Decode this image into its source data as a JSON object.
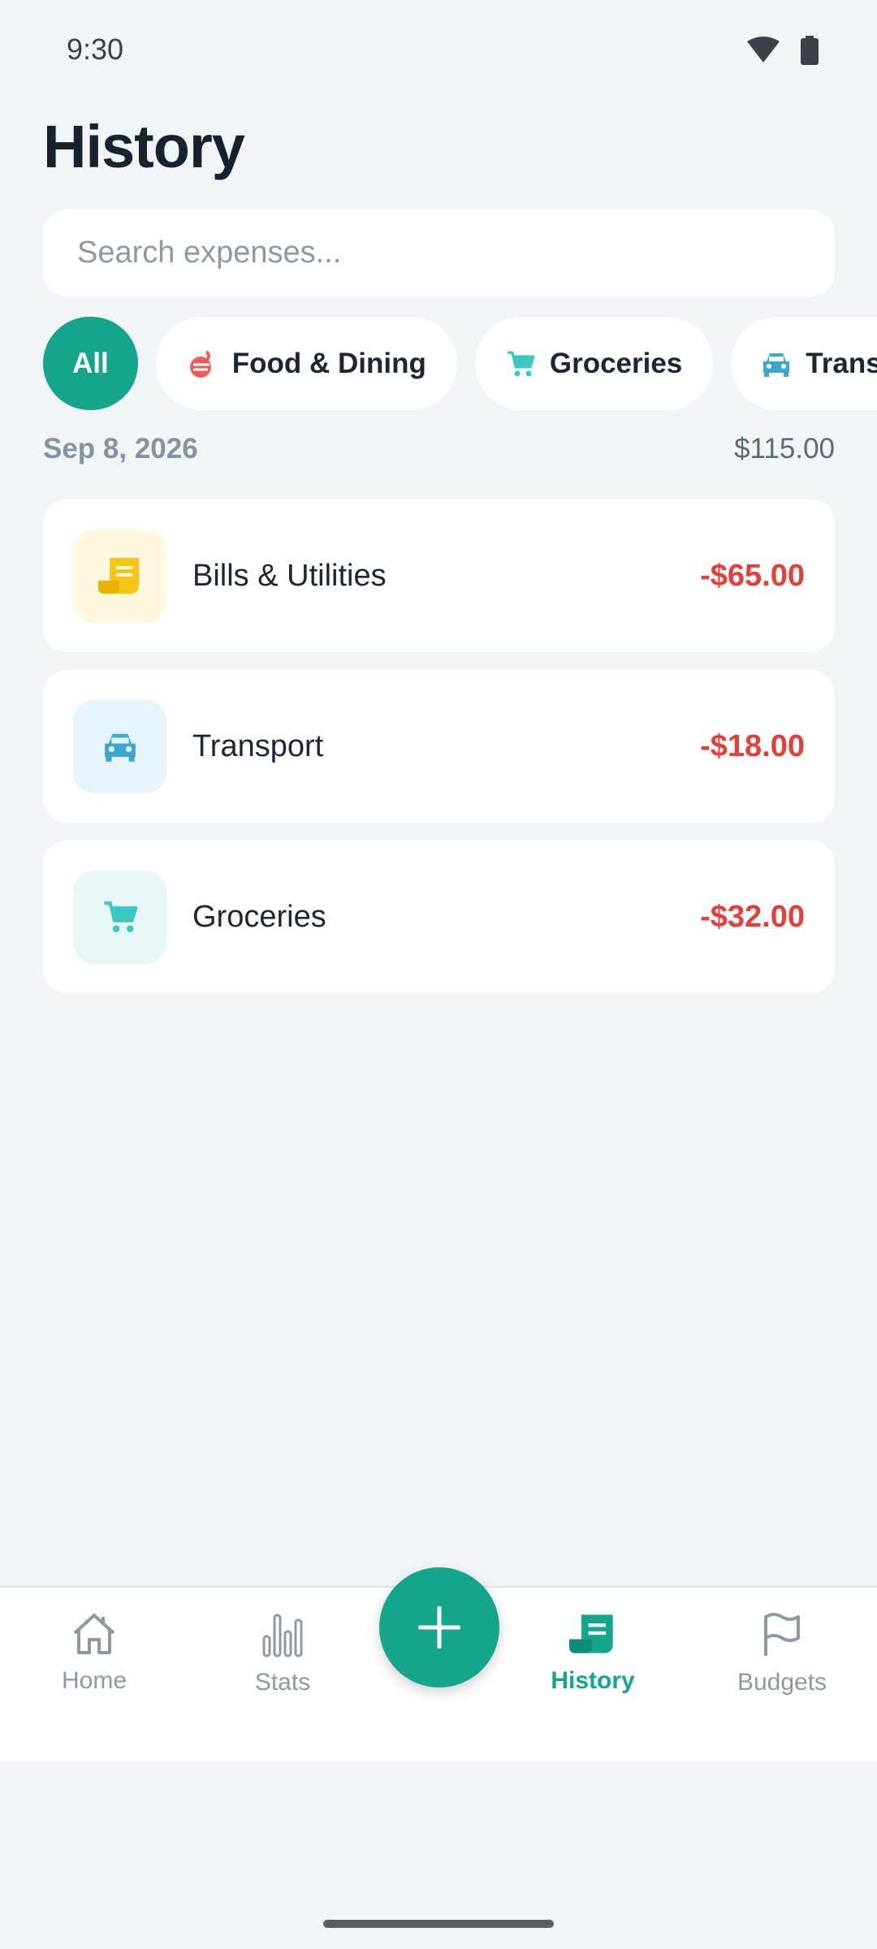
{
  "status_bar": {
    "time": "9:30"
  },
  "page": {
    "title": "History"
  },
  "search": {
    "placeholder": "Search expenses..."
  },
  "filters": [
    {
      "label": "All",
      "icon": "",
      "active": true
    },
    {
      "label": "Food & Dining",
      "icon": "food-icon",
      "active": false
    },
    {
      "label": "Groceries",
      "icon": "cart-icon",
      "active": false
    },
    {
      "label": "Transpor",
      "icon": "car-icon",
      "active": false
    }
  ],
  "groups": [
    {
      "date": "Sep 8, 2026",
      "total": "$115.00",
      "transactions": [
        {
          "name": "Bills & Utilities",
          "amount": "-$65.00",
          "icon": "receipt-icon",
          "icon_color": "#f5c518",
          "icon_bg": "#fff8e1"
        },
        {
          "name": "Transport",
          "amount": "-$18.00",
          "icon": "car-icon",
          "icon_color": "#3aa9cc",
          "icon_bg": "#e6f4fa"
        },
        {
          "name": "Groceries",
          "amount": "-$32.00",
          "icon": "cart-icon",
          "icon_color": "#3cc7c2",
          "icon_bg": "#e6f7f6"
        }
      ]
    }
  ],
  "bottom_nav": {
    "items": [
      {
        "label": "Home",
        "icon": "home-icon"
      },
      {
        "label": "Stats",
        "icon": "bar-chart-icon"
      },
      {
        "label": "History",
        "icon": "receipt-icon",
        "active": true
      },
      {
        "label": "Budgets",
        "icon": "flag-icon"
      }
    ],
    "fab_icon": "plus-icon"
  },
  "colors": {
    "accent": "#14a58a",
    "expense": "#e2403b",
    "background": "#f1f5f6"
  }
}
